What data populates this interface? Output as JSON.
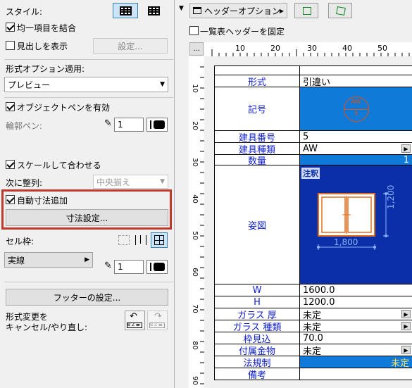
{
  "left": {
    "style_label": "スタイル:",
    "merge_label": "均一項目を結合",
    "heading_label": "見出しを表示",
    "settings_button": "設定...",
    "format_option_label": "形式オプション適用:",
    "format_option_value": "プレビュー",
    "object_pen_label": "オブジェクトペンを有効",
    "outline_pen_label": "輪郭ペン:",
    "outline_pen_value": "1",
    "scale_fit_label": "スケールして合わせる",
    "align_label": "次に整列:",
    "align_value": "中央揃え",
    "auto_dim_label": "自動寸法追加",
    "dim_settings_button": "寸法設定...",
    "cell_frame_label": "セル枠:",
    "line_type_value": "実線",
    "line_pen_value": "1",
    "footer_button": "フッターの設定...",
    "undo_label_1": "形式変更を",
    "undo_label_2": "キャンセル/やり直し:",
    "highlight_color": "#c0392b"
  },
  "right": {
    "header_option_label": "ヘッダーオプション",
    "fix_header_label": "一覧表ヘッダーを固定",
    "ruler_button": "...",
    "ruler_ticks": [
      "10",
      "20",
      "30",
      "40",
      "50"
    ],
    "vruler_ticks": [
      "10",
      "20",
      "30",
      "40",
      "50",
      "60",
      "70",
      "80",
      "90"
    ],
    "rows": [
      {
        "label": "形式",
        "value": "引違い"
      },
      {
        "label": "記号",
        "value": ""
      },
      {
        "label": "建具番号",
        "value": "5"
      },
      {
        "label": "建具種類",
        "value": "AW"
      },
      {
        "label": "数量",
        "value": "1"
      },
      {
        "label": "姿図",
        "value": ""
      },
      {
        "label": "W",
        "value": "1600.0"
      },
      {
        "label": "H",
        "value": "1200.0"
      },
      {
        "label": "ガラス 厚",
        "value": "未定"
      },
      {
        "label": "ガラス 種類",
        "value": "未定"
      },
      {
        "label": "枠見込",
        "value": "70.0"
      },
      {
        "label": "付属金物",
        "value": "未定"
      },
      {
        "label": "法規制",
        "value": "未定"
      },
      {
        "label": "備考",
        "value": ""
      }
    ],
    "symbol_top": "AW",
    "symbol_bottom": "5",
    "annotation_label": "注釈",
    "dim_width": "1,800",
    "dim_height": "1,200",
    "accent_blue": "#0f7ad8",
    "dark_blue": "#0a2fa8"
  }
}
